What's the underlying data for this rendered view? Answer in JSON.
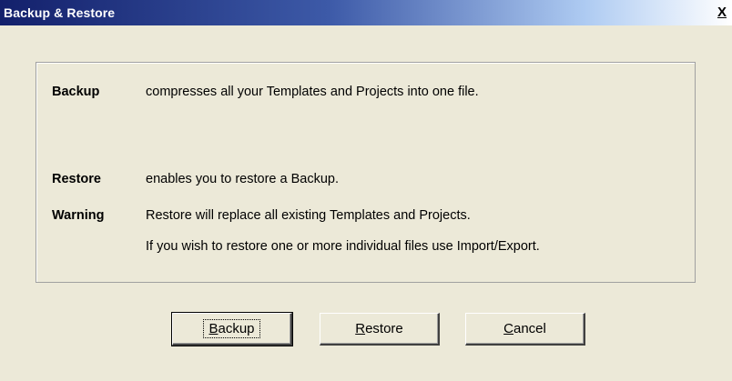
{
  "window": {
    "title": "Backup & Restore",
    "close_icon": "close-icon",
    "close_glyph": "X"
  },
  "info": {
    "backup": {
      "label": "Backup",
      "text": "compresses all your Templates and Projects into one file."
    },
    "restore": {
      "label": "Restore",
      "text": "enables you to restore a Backup."
    },
    "warning": {
      "label": "Warning",
      "text1": "Restore will replace all existing Templates and Projects.",
      "text2": "If you wish to restore one or more individual files use Import/Export."
    }
  },
  "buttons": {
    "backup": {
      "mnemonic": "B",
      "rest": "ackup"
    },
    "restore": {
      "mnemonic": "R",
      "rest": "estore"
    },
    "cancel": {
      "mnemonic": "C",
      "rest": "ancel"
    }
  }
}
